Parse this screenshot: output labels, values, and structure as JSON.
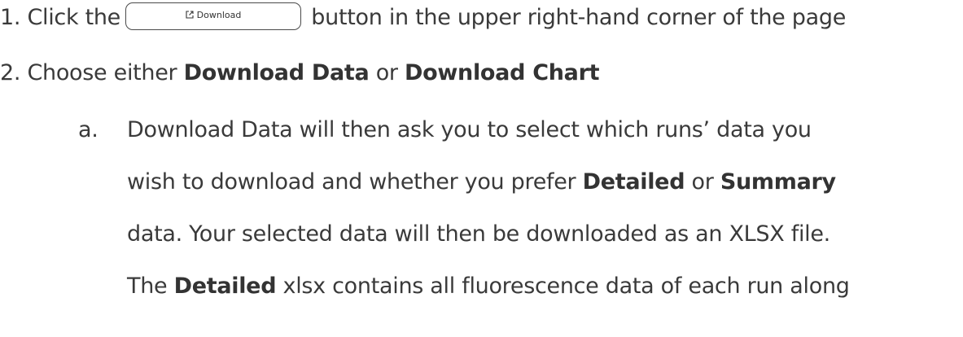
{
  "steps": [
    {
      "number": "1.",
      "text_before": "Click the",
      "button": {
        "label": "Download",
        "icon": "external-link-icon"
      },
      "text_after": "button in the upper right-hand corner of the page"
    },
    {
      "number": "2.",
      "text_before": "Choose either",
      "bold_1": "Download Data",
      "text_mid": "or",
      "bold_2": "Download Chart"
    }
  ],
  "substep_a": {
    "letter": "a.",
    "line1": "Download Data will then ask you to select which runs’ data you",
    "line2_before": "wish to download and whether you prefer",
    "line2_bold_1": "Detailed",
    "line2_mid": "or",
    "line2_bold_2": "Summary",
    "line3": "data. Your selected data will then be downloaded as an XLSX file.",
    "line4_before": "The",
    "line4_bold": "Detailed",
    "line4_after": "xlsx contains all fluorescence data of each run along"
  }
}
